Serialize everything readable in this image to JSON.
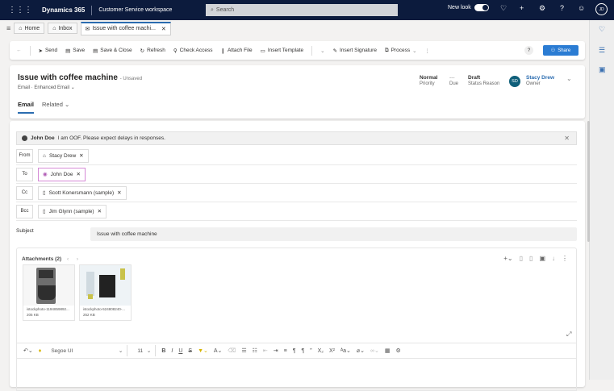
{
  "topbar": {
    "brand": "Dynamics 365",
    "workspace": "Customer Service workspace",
    "search_placeholder": "Search",
    "new_look": "New look",
    "user_initials": "JD"
  },
  "tabs": [
    {
      "label": "Home"
    },
    {
      "label": "Inbox"
    },
    {
      "label": "Issue with coffee machi..."
    }
  ],
  "commands": {
    "send": "Send",
    "save": "Save",
    "save_close": "Save & Close",
    "refresh": "Refresh",
    "check_access": "Check Access",
    "attach_file": "Attach File",
    "insert_template": "Insert Template",
    "insert_signature": "Insert Signature",
    "process": "Process",
    "share": "Share",
    "help": "?"
  },
  "header": {
    "title": "Issue with coffee machine",
    "unsaved": "- Unsaved",
    "entity": "Email",
    "form": "Enhanced Email",
    "priority_value": "Normal",
    "priority_label": "Priority",
    "due_value": "---",
    "due_label": "Due",
    "status_value": "Draft",
    "status_label": "Status Reason",
    "owner_initials": "SD",
    "owner_name": "Stacy Drew",
    "owner_label": "Owner"
  },
  "form_tabs": {
    "email": "Email",
    "related": "Related"
  },
  "oof": {
    "name": "John Doe",
    "message": "I am OOF. Please expect delays in responses."
  },
  "fields": {
    "from": {
      "label": "From",
      "value": "Stacy Drew"
    },
    "to": {
      "label": "To",
      "value": "John Doe"
    },
    "cc": {
      "label": "Cc",
      "value": "Scott Konersmann (sample)"
    },
    "bcc": {
      "label": "Bcc",
      "value": "Jim Glynn (sample)"
    },
    "subject": {
      "label": "Subject",
      "value": "Issue with coffee machine"
    }
  },
  "attachments": {
    "title": "Attachments (2)",
    "items": [
      {
        "name": "istockphoto-1194859892...",
        "size": "205 KB"
      },
      {
        "name": "istockphoto-524808240-...",
        "size": "252 KB"
      }
    ]
  },
  "editor": {
    "font": "Segoe UI",
    "size": "11"
  }
}
